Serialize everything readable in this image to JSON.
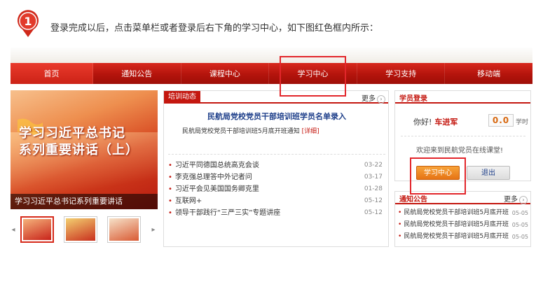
{
  "step": {
    "number": "1",
    "instruction": "登录完成以后，点击菜单栏或者登录后右下角的学习中心，如下图红色框内所示："
  },
  "nav": {
    "items": [
      "首页",
      "通知公告",
      "课程中心",
      "学习中心",
      "学习支持",
      "移动端"
    ]
  },
  "banner": {
    "title_line1": "学习习近平总书记",
    "title_line2": "系列重要讲话（上）",
    "caption": "学习习近平总书记系列重要讲话"
  },
  "news": {
    "tab_label": "培训动态",
    "more_label": "更多",
    "headline": "民航局党校党员干部培训班学员名单录入",
    "sub_text": "民航局党校党员干部培训班5月底开班通知",
    "detail_label": "[详细]",
    "items": [
      {
        "title": "习近平同德国总统高克会谈",
        "date": "03-22"
      },
      {
        "title": "李克强总理答中外记者问",
        "date": "03-17"
      },
      {
        "title": "习近平会见美国国务卿克里",
        "date": "01-28"
      },
      {
        "title": "互联网+",
        "date": "05-12"
      },
      {
        "title": "领导干部践行“三严三实”专题讲座",
        "date": "05-12"
      }
    ]
  },
  "login": {
    "title": "学员登录",
    "greeting": "你好!",
    "username": "车进军",
    "hours_value": "0.0",
    "hours_unit": "学时",
    "welcome": "欢迎来到民航党员在线课堂!",
    "study_button": "学习中心",
    "exit_button": "退出"
  },
  "notice": {
    "title": "通知公告",
    "more_label": "更多",
    "items": [
      {
        "title": "民航局党校党员干部培训班5月底开班",
        "date": "05-05"
      },
      {
        "title": "民航局党校党员干部培训班5月底开班",
        "date": "05-05"
      },
      {
        "title": "民航局党校党员干部培训班5月底开班",
        "date": "05-05"
      }
    ]
  },
  "colors": {
    "nav_red": "#b4140c",
    "highlight_red": "#e2262b",
    "study_orange": "#e67314"
  }
}
